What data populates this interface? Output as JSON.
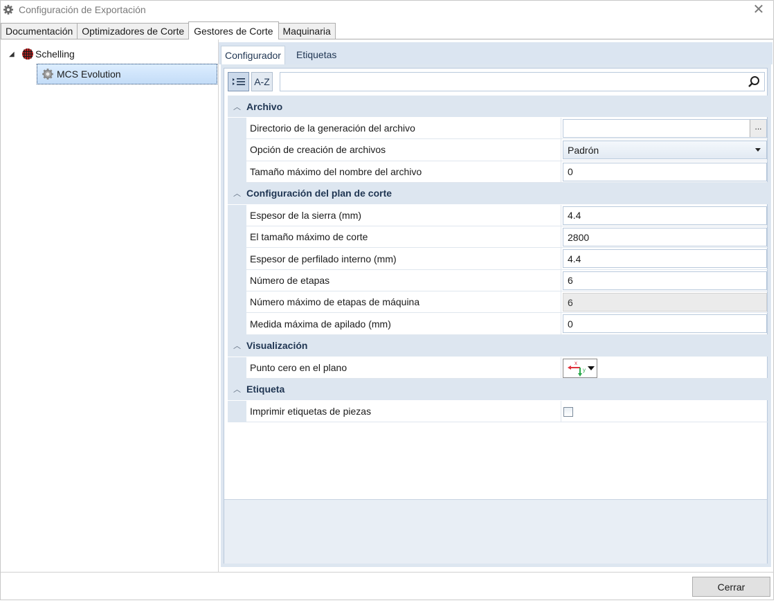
{
  "window": {
    "title": "Configuración de Exportación",
    "close_glyph": "✕"
  },
  "top_tabs": [
    {
      "label": "Documentación",
      "active": false
    },
    {
      "label": "Optimizadores de Corte",
      "active": false
    },
    {
      "label": "Gestores de Corte",
      "active": true
    },
    {
      "label": "Maquinaria",
      "active": false
    }
  ],
  "tree": {
    "root": {
      "label": "Schelling",
      "expander": "◢",
      "icon": "schelling-logo-icon"
    },
    "child": {
      "label": "MCS Evolution",
      "icon": "gear-icon"
    }
  },
  "inner_tabs": [
    {
      "label": "Configurador",
      "active": true
    },
    {
      "label": "Etiquetas",
      "active": false
    }
  ],
  "toolbar": {
    "categorized_icon": "categorized-list-icon",
    "az_label": "A-Z",
    "search_placeholder": "",
    "search_icon": "search-icon"
  },
  "categories": {
    "archivo": {
      "label": "Archivo",
      "rows": {
        "directorio": {
          "label": "Directorio de la generación del archivo",
          "value": "",
          "browse": "..."
        },
        "opcion": {
          "label": "Opción de creación de archivos",
          "value": "Padrón"
        },
        "tamano_nombre": {
          "label": "Tamaño máximo del nombre del archivo",
          "value": "0"
        }
      }
    },
    "plan": {
      "label": "Configuración del plan de corte",
      "rows": {
        "espesor_sierra": {
          "label": "Espesor de la sierra (mm)",
          "value": "4.4"
        },
        "tamano_corte": {
          "label": "El tamaño máximo de corte",
          "value": "2800"
        },
        "espesor_perfilado": {
          "label": "Espesor de perfilado interno (mm)",
          "value": "4.4"
        },
        "num_etapas": {
          "label": "Número de etapas",
          "value": "6"
        },
        "num_max_etapas": {
          "label": "Número máximo de etapas de máquina",
          "value": "6",
          "disabled": true
        },
        "medida_apilado": {
          "label": "Medida máxima de apilado (mm)",
          "value": "0"
        }
      }
    },
    "visualizacion": {
      "label": "Visualización",
      "rows": {
        "punto_cero": {
          "label": "Punto cero en el plano",
          "icon": "axis-origin-icon",
          "axis_x": "x",
          "axis_y": "y"
        }
      }
    },
    "etiqueta": {
      "label": "Etiqueta",
      "rows": {
        "imprimir": {
          "label": "Imprimir etiquetas de piezas",
          "checked": false
        }
      }
    }
  },
  "footer": {
    "close_label": "Cerrar"
  },
  "colors": {
    "accent": "#1f3552",
    "category_bg": "#dde6f0",
    "selection": "#c3dcf7",
    "axis_red": "#e0303a",
    "axis_green": "#2aa84a"
  }
}
